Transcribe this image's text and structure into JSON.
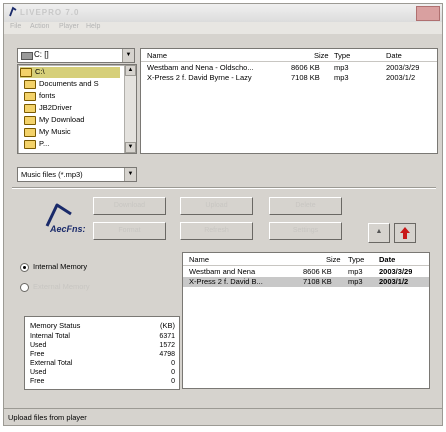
{
  "window": {
    "title": "LIVEPRO 7.0",
    "menu": [
      "File",
      "Action",
      "Player",
      "Help"
    ]
  },
  "drive": {
    "label": "C: []"
  },
  "folders": [
    {
      "label": "C:\\",
      "selected": true
    },
    {
      "label": "Documents and S"
    },
    {
      "label": "fonts"
    },
    {
      "label": "JB2Driver"
    },
    {
      "label": "My Download"
    },
    {
      "label": "My Music"
    },
    {
      "label": "P..."
    }
  ],
  "filter": {
    "label": "Music files (*.mp3)"
  },
  "pc_files": {
    "columns": [
      "Name",
      "Size",
      "Type",
      "Date"
    ],
    "rows": [
      {
        "name": "Westbam and Nena - Oldscho...",
        "size": "8606 KB",
        "type": "mp3",
        "date": "2003/3/29"
      },
      {
        "name": "X-Press 2 f. David Byrne - Lazy",
        "size": "7108 KB",
        "type": "mp3",
        "date": "2003/1/2"
      }
    ]
  },
  "buttons": {
    "row1": [
      "Download",
      "Upload",
      "Delete"
    ],
    "row2": [
      "Format",
      "Refresh",
      "Settings"
    ]
  },
  "logo": {
    "text": "AecFns:"
  },
  "memory_select": {
    "internal": "Internal Memory",
    "external": "External Memory"
  },
  "player_files": {
    "columns": [
      "Name",
      "Size",
      "Type",
      "Date"
    ],
    "rows": [
      {
        "name": "Westbam and Nena",
        "size": "8606 KB",
        "type": "mp3",
        "date": "2003/3/29",
        "selected": false
      },
      {
        "name": "X-Press 2 f. David B...",
        "size": "7108 KB",
        "type": "mp3",
        "date": "2003/1/2",
        "selected": true
      }
    ]
  },
  "memory_status": {
    "title": "Memory Status",
    "unit": "(KB)",
    "rows": [
      {
        "label": "Internal Total",
        "value": "6371"
      },
      {
        "label": "Used",
        "value": "1572"
      },
      {
        "label": "Free",
        "value": "4798"
      },
      {
        "label": "External Total",
        "value": "0"
      },
      {
        "label": "Used",
        "value": "0"
      },
      {
        "label": "Free",
        "value": "0"
      }
    ]
  },
  "status": {
    "text": "Upload files from player"
  },
  "colors": {
    "accent_red": "#c81818",
    "logo_blue": "#1a2a6a"
  }
}
